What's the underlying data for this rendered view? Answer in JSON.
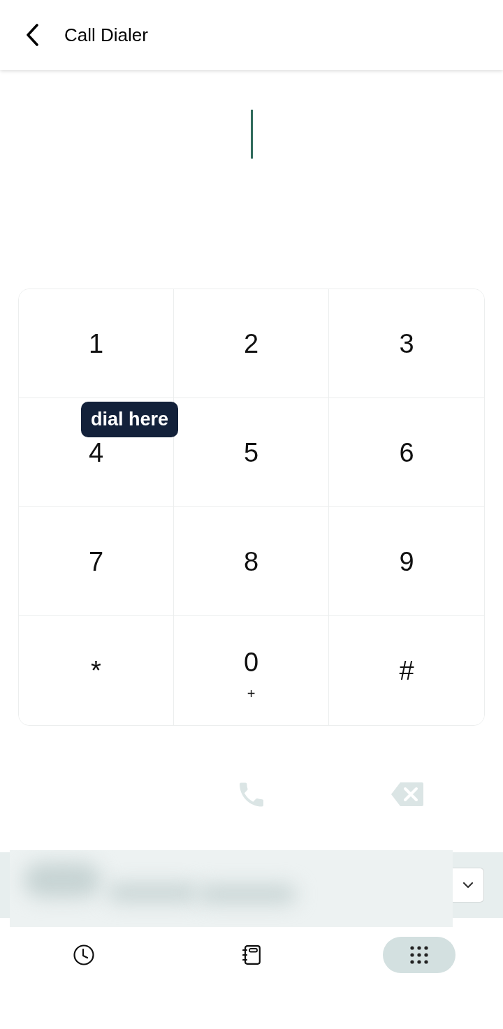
{
  "header": {
    "title": "Call Dialer"
  },
  "number_field": {
    "focused": true
  },
  "keypad": {
    "keys": [
      {
        "label": "1"
      },
      {
        "label": "2"
      },
      {
        "label": "3"
      },
      {
        "label": "4"
      },
      {
        "label": "5"
      },
      {
        "label": "6"
      },
      {
        "label": "7"
      },
      {
        "label": "8"
      },
      {
        "label": "9"
      },
      {
        "label": "*"
      },
      {
        "label": "0",
        "sublabel": "+"
      },
      {
        "label": "#"
      }
    ]
  },
  "tooltip": {
    "text": "dial here"
  },
  "actions": [
    {
      "kind": "call",
      "disabled": true
    },
    {
      "kind": "backspace",
      "disabled": true
    }
  ],
  "nav": {
    "items": [
      {
        "kind": "history",
        "selected": false
      },
      {
        "kind": "contacts",
        "selected": false
      },
      {
        "kind": "keypad",
        "selected": true
      }
    ]
  }
}
